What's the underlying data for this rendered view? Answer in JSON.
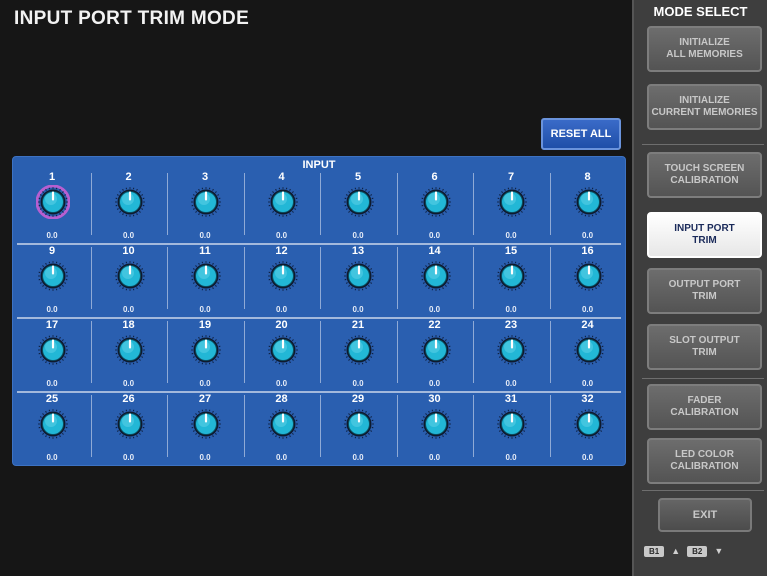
{
  "title": "INPUT PORT TRIM MODE",
  "reset_all_label": "RESET ALL",
  "panel_title": "INPUT",
  "rows": [
    {
      "cells": [
        {
          "num": "1",
          "value": "0.0",
          "selected": true
        },
        {
          "num": "2",
          "value": "0.0"
        },
        {
          "num": "3",
          "value": "0.0"
        },
        {
          "num": "4",
          "value": "0.0"
        },
        {
          "num": "5",
          "value": "0.0"
        },
        {
          "num": "6",
          "value": "0.0"
        },
        {
          "num": "7",
          "value": "0.0"
        },
        {
          "num": "8",
          "value": "0.0"
        }
      ]
    },
    {
      "cells": [
        {
          "num": "9",
          "value": "0.0"
        },
        {
          "num": "10",
          "value": "0.0"
        },
        {
          "num": "11",
          "value": "0.0"
        },
        {
          "num": "12",
          "value": "0.0"
        },
        {
          "num": "13",
          "value": "0.0"
        },
        {
          "num": "14",
          "value": "0.0"
        },
        {
          "num": "15",
          "value": "0.0"
        },
        {
          "num": "16",
          "value": "0.0"
        }
      ]
    },
    {
      "cells": [
        {
          "num": "17",
          "value": "0.0"
        },
        {
          "num": "18",
          "value": "0.0"
        },
        {
          "num": "19",
          "value": "0.0"
        },
        {
          "num": "20",
          "value": "0.0"
        },
        {
          "num": "21",
          "value": "0.0"
        },
        {
          "num": "22",
          "value": "0.0"
        },
        {
          "num": "23",
          "value": "0.0"
        },
        {
          "num": "24",
          "value": "0.0"
        }
      ]
    },
    {
      "cells": [
        {
          "num": "25",
          "value": "0.0"
        },
        {
          "num": "26",
          "value": "0.0"
        },
        {
          "num": "27",
          "value": "0.0"
        },
        {
          "num": "28",
          "value": "0.0"
        },
        {
          "num": "29",
          "value": "0.0"
        },
        {
          "num": "30",
          "value": "0.0"
        },
        {
          "num": "31",
          "value": "0.0"
        },
        {
          "num": "32",
          "value": "0.0"
        }
      ]
    }
  ],
  "sidebar": {
    "title": "MODE SELECT",
    "buttons": [
      {
        "label": "INITIALIZE\nALL MEMORIES",
        "active": false
      },
      {
        "label": "INITIALIZE\nCURRENT MEMORIES",
        "active": false
      },
      {
        "label": "TOUCH SCREEN\nCALIBRATION",
        "active": false
      },
      {
        "label": "INPUT PORT\nTRIM",
        "active": true
      },
      {
        "label": "OUTPUT PORT\nTRIM",
        "active": false
      },
      {
        "label": "SLOT OUTPUT\nTRIM",
        "active": false
      },
      {
        "label": "FADER\nCALIBRATION",
        "active": false
      },
      {
        "label": "LED COLOR\nCALIBRATION",
        "active": false
      }
    ],
    "exit_label": "EXIT",
    "bank_left": "B1",
    "bank_right": "B2"
  },
  "colors": {
    "panel": "#2a5fb0",
    "knob": "#22b7d6",
    "selected_ring": "#b75fd0",
    "reset_button": "#2d5fbf"
  },
  "icons": {
    "knob": "rotary-knob-icon",
    "arrow_up": "triangle-up-icon",
    "arrow_down": "triangle-down-icon"
  }
}
